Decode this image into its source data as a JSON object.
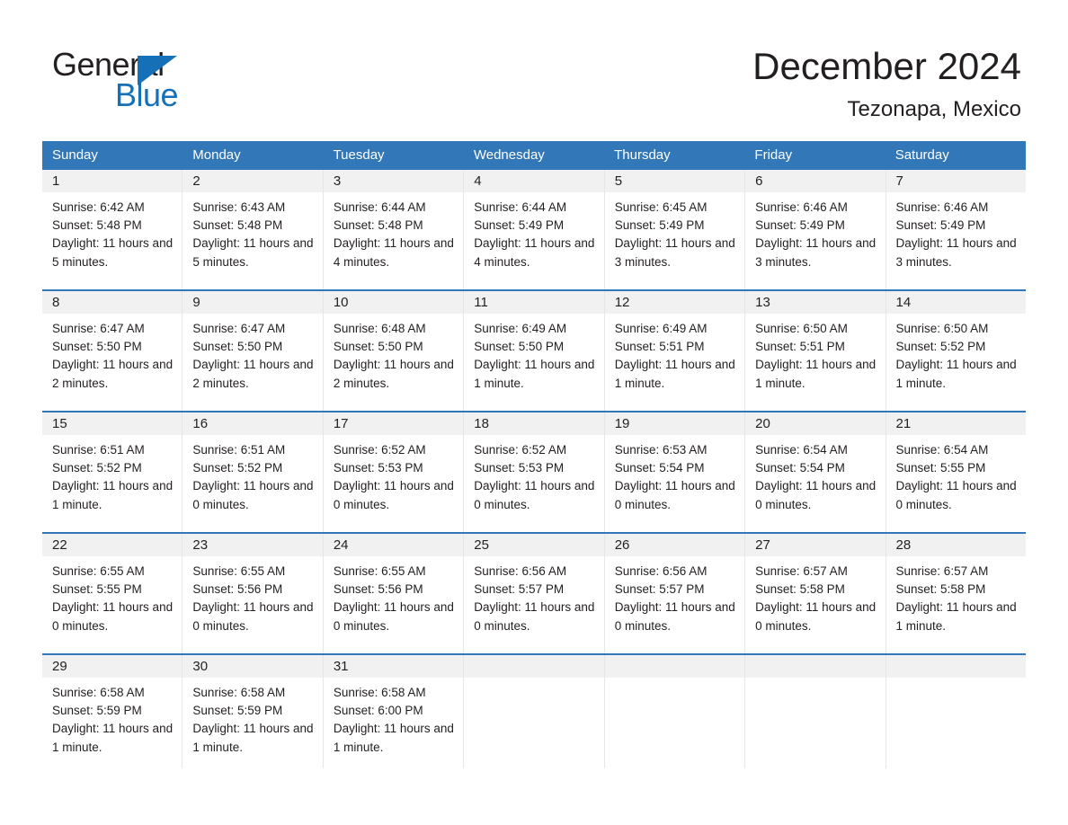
{
  "brand": {
    "name_part1": "General",
    "name_part2": "Blue",
    "triangle_color": "#1670b8",
    "logo_icon": "general-blue-triangle-icon"
  },
  "header": {
    "title": "December 2024",
    "subtitle": "Tezonapa, Mexico"
  },
  "colors": {
    "header_blue": "#3277b7",
    "daynum_band": "#f1f1f1",
    "brand_blue": "#1670b8",
    "text": "#231f20"
  },
  "calendar": {
    "day_headers": [
      "Sunday",
      "Monday",
      "Tuesday",
      "Wednesday",
      "Thursday",
      "Friday",
      "Saturday"
    ],
    "weeks": [
      [
        {
          "day": "1",
          "sunrise": "Sunrise: 6:42 AM",
          "sunset": "Sunset: 5:48 PM",
          "daylight": "Daylight: 11 hours and 5 minutes."
        },
        {
          "day": "2",
          "sunrise": "Sunrise: 6:43 AM",
          "sunset": "Sunset: 5:48 PM",
          "daylight": "Daylight: 11 hours and 5 minutes."
        },
        {
          "day": "3",
          "sunrise": "Sunrise: 6:44 AM",
          "sunset": "Sunset: 5:48 PM",
          "daylight": "Daylight: 11 hours and 4 minutes."
        },
        {
          "day": "4",
          "sunrise": "Sunrise: 6:44 AM",
          "sunset": "Sunset: 5:49 PM",
          "daylight": "Daylight: 11 hours and 4 minutes."
        },
        {
          "day": "5",
          "sunrise": "Sunrise: 6:45 AM",
          "sunset": "Sunset: 5:49 PM",
          "daylight": "Daylight: 11 hours and 3 minutes."
        },
        {
          "day": "6",
          "sunrise": "Sunrise: 6:46 AM",
          "sunset": "Sunset: 5:49 PM",
          "daylight": "Daylight: 11 hours and 3 minutes."
        },
        {
          "day": "7",
          "sunrise": "Sunrise: 6:46 AM",
          "sunset": "Sunset: 5:49 PM",
          "daylight": "Daylight: 11 hours and 3 minutes."
        }
      ],
      [
        {
          "day": "8",
          "sunrise": "Sunrise: 6:47 AM",
          "sunset": "Sunset: 5:50 PM",
          "daylight": "Daylight: 11 hours and 2 minutes."
        },
        {
          "day": "9",
          "sunrise": "Sunrise: 6:47 AM",
          "sunset": "Sunset: 5:50 PM",
          "daylight": "Daylight: 11 hours and 2 minutes."
        },
        {
          "day": "10",
          "sunrise": "Sunrise: 6:48 AM",
          "sunset": "Sunset: 5:50 PM",
          "daylight": "Daylight: 11 hours and 2 minutes."
        },
        {
          "day": "11",
          "sunrise": "Sunrise: 6:49 AM",
          "sunset": "Sunset: 5:50 PM",
          "daylight": "Daylight: 11 hours and 1 minute."
        },
        {
          "day": "12",
          "sunrise": "Sunrise: 6:49 AM",
          "sunset": "Sunset: 5:51 PM",
          "daylight": "Daylight: 11 hours and 1 minute."
        },
        {
          "day": "13",
          "sunrise": "Sunrise: 6:50 AM",
          "sunset": "Sunset: 5:51 PM",
          "daylight": "Daylight: 11 hours and 1 minute."
        },
        {
          "day": "14",
          "sunrise": "Sunrise: 6:50 AM",
          "sunset": "Sunset: 5:52 PM",
          "daylight": "Daylight: 11 hours and 1 minute."
        }
      ],
      [
        {
          "day": "15",
          "sunrise": "Sunrise: 6:51 AM",
          "sunset": "Sunset: 5:52 PM",
          "daylight": "Daylight: 11 hours and 1 minute."
        },
        {
          "day": "16",
          "sunrise": "Sunrise: 6:51 AM",
          "sunset": "Sunset: 5:52 PM",
          "daylight": "Daylight: 11 hours and 0 minutes."
        },
        {
          "day": "17",
          "sunrise": "Sunrise: 6:52 AM",
          "sunset": "Sunset: 5:53 PM",
          "daylight": "Daylight: 11 hours and 0 minutes."
        },
        {
          "day": "18",
          "sunrise": "Sunrise: 6:52 AM",
          "sunset": "Sunset: 5:53 PM",
          "daylight": "Daylight: 11 hours and 0 minutes."
        },
        {
          "day": "19",
          "sunrise": "Sunrise: 6:53 AM",
          "sunset": "Sunset: 5:54 PM",
          "daylight": "Daylight: 11 hours and 0 minutes."
        },
        {
          "day": "20",
          "sunrise": "Sunrise: 6:54 AM",
          "sunset": "Sunset: 5:54 PM",
          "daylight": "Daylight: 11 hours and 0 minutes."
        },
        {
          "day": "21",
          "sunrise": "Sunrise: 6:54 AM",
          "sunset": "Sunset: 5:55 PM",
          "daylight": "Daylight: 11 hours and 0 minutes."
        }
      ],
      [
        {
          "day": "22",
          "sunrise": "Sunrise: 6:55 AM",
          "sunset": "Sunset: 5:55 PM",
          "daylight": "Daylight: 11 hours and 0 minutes."
        },
        {
          "day": "23",
          "sunrise": "Sunrise: 6:55 AM",
          "sunset": "Sunset: 5:56 PM",
          "daylight": "Daylight: 11 hours and 0 minutes."
        },
        {
          "day": "24",
          "sunrise": "Sunrise: 6:55 AM",
          "sunset": "Sunset: 5:56 PM",
          "daylight": "Daylight: 11 hours and 0 minutes."
        },
        {
          "day": "25",
          "sunrise": "Sunrise: 6:56 AM",
          "sunset": "Sunset: 5:57 PM",
          "daylight": "Daylight: 11 hours and 0 minutes."
        },
        {
          "day": "26",
          "sunrise": "Sunrise: 6:56 AM",
          "sunset": "Sunset: 5:57 PM",
          "daylight": "Daylight: 11 hours and 0 minutes."
        },
        {
          "day": "27",
          "sunrise": "Sunrise: 6:57 AM",
          "sunset": "Sunset: 5:58 PM",
          "daylight": "Daylight: 11 hours and 0 minutes."
        },
        {
          "day": "28",
          "sunrise": "Sunrise: 6:57 AM",
          "sunset": "Sunset: 5:58 PM",
          "daylight": "Daylight: 11 hours and 1 minute."
        }
      ],
      [
        {
          "day": "29",
          "sunrise": "Sunrise: 6:58 AM",
          "sunset": "Sunset: 5:59 PM",
          "daylight": "Daylight: 11 hours and 1 minute."
        },
        {
          "day": "30",
          "sunrise": "Sunrise: 6:58 AM",
          "sunset": "Sunset: 5:59 PM",
          "daylight": "Daylight: 11 hours and 1 minute."
        },
        {
          "day": "31",
          "sunrise": "Sunrise: 6:58 AM",
          "sunset": "Sunset: 6:00 PM",
          "daylight": "Daylight: 11 hours and 1 minute."
        },
        {
          "day": "",
          "sunrise": "",
          "sunset": "",
          "daylight": ""
        },
        {
          "day": "",
          "sunrise": "",
          "sunset": "",
          "daylight": ""
        },
        {
          "day": "",
          "sunrise": "",
          "sunset": "",
          "daylight": ""
        },
        {
          "day": "",
          "sunrise": "",
          "sunset": "",
          "daylight": ""
        }
      ]
    ]
  }
}
